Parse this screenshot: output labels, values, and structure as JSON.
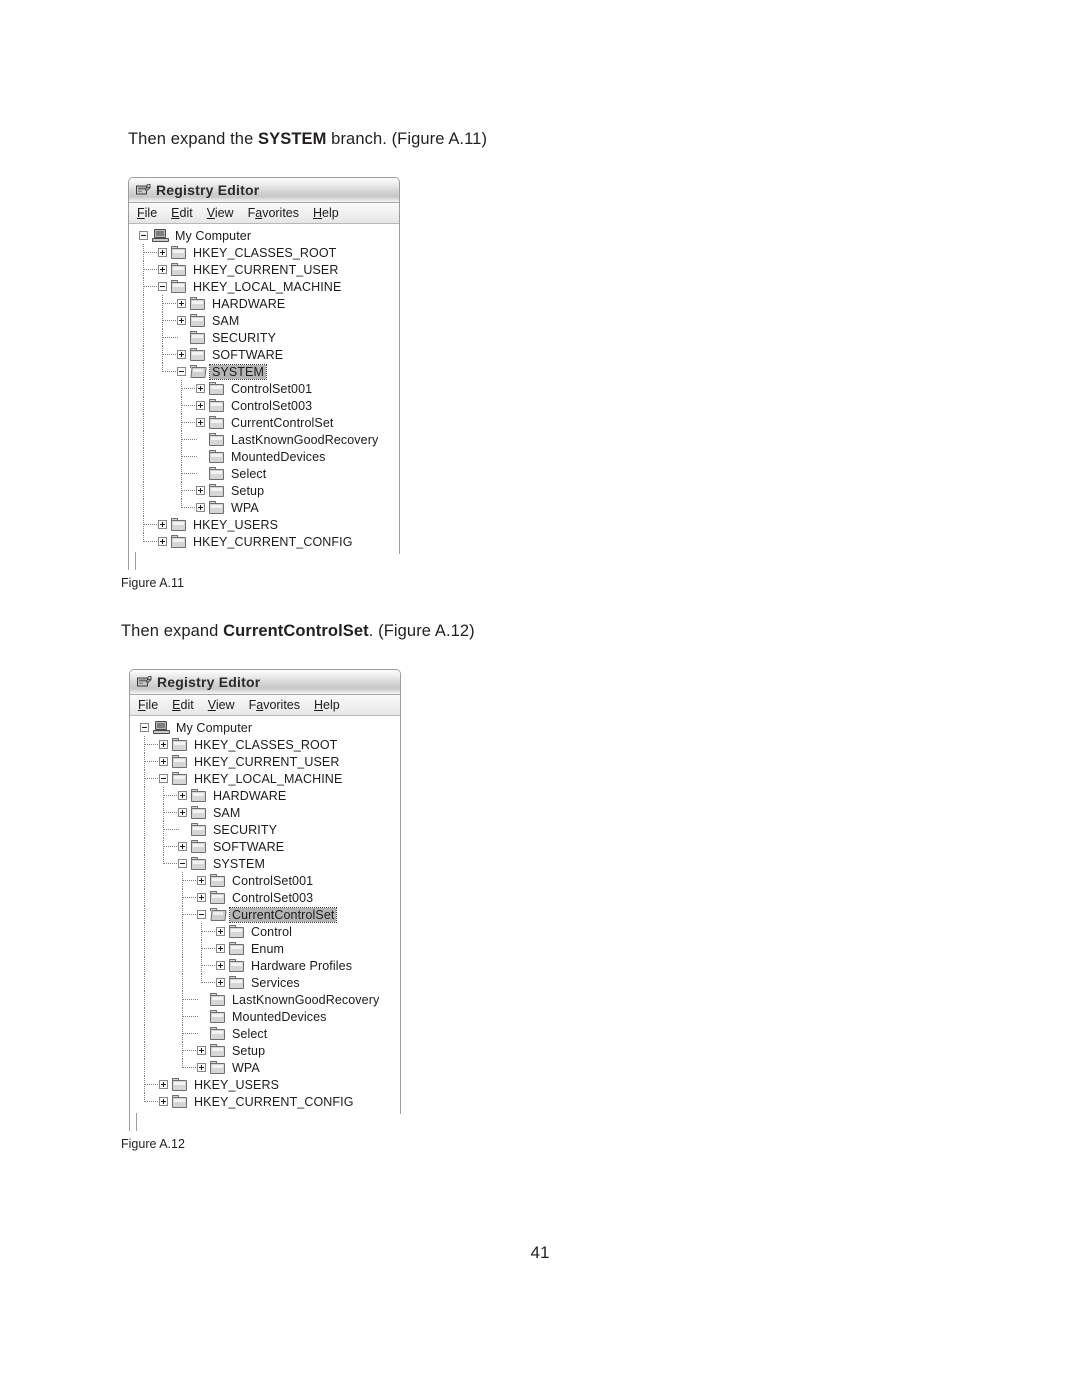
{
  "page": {
    "number": "41"
  },
  "paragraphs": [
    {
      "id": "para-1",
      "prefix": "Then expand the ",
      "emphasis": "SYSTEM",
      "suffix": " branch. (Figure A.11)"
    },
    {
      "id": "para-2",
      "prefix": "Then expand ",
      "emphasis": "CurrentControlSet",
      "suffix": ". (Figure A.12)"
    }
  ],
  "captions": {
    "figure_a11": "Figure A.11",
    "figure_a12": "Figure A.12"
  },
  "window": {
    "title": "Registry Editor",
    "title_icon": "registry-editor-icon",
    "menu": [
      {
        "pre": "",
        "key": "F",
        "post": "ile"
      },
      {
        "pre": "",
        "key": "E",
        "post": "dit"
      },
      {
        "pre": "",
        "key": "V",
        "post": "iew"
      },
      {
        "pre": "F",
        "key": "a",
        "post": "vorites"
      },
      {
        "pre": "",
        "key": "H",
        "post": "elp"
      }
    ]
  },
  "figure_a11": {
    "tree": [
      {
        "label": "My Computer",
        "depth": 0,
        "icon": "computer-icon",
        "expander": "minus",
        "selected": false
      },
      {
        "label": "HKEY_CLASSES_ROOT",
        "depth": 1,
        "icon": "folder-icon",
        "expander": "plus",
        "selected": false
      },
      {
        "label": "HKEY_CURRENT_USER",
        "depth": 1,
        "icon": "folder-icon",
        "expander": "plus",
        "selected": false
      },
      {
        "label": "HKEY_LOCAL_MACHINE",
        "depth": 1,
        "icon": "folder-icon",
        "expander": "minus",
        "selected": false
      },
      {
        "label": "HARDWARE",
        "depth": 2,
        "icon": "folder-icon",
        "expander": "plus",
        "selected": false
      },
      {
        "label": "SAM",
        "depth": 2,
        "icon": "folder-icon",
        "expander": "plus",
        "selected": false
      },
      {
        "label": "SECURITY",
        "depth": 2,
        "icon": "folder-icon",
        "expander": "none",
        "selected": false
      },
      {
        "label": "SOFTWARE",
        "depth": 2,
        "icon": "folder-icon",
        "expander": "plus",
        "selected": false
      },
      {
        "label": "SYSTEM",
        "depth": 2,
        "icon": "folder-open-icon",
        "expander": "minus",
        "selected": true
      },
      {
        "label": "ControlSet001",
        "depth": 3,
        "icon": "folder-icon",
        "expander": "plus",
        "selected": false
      },
      {
        "label": "ControlSet003",
        "depth": 3,
        "icon": "folder-icon",
        "expander": "plus",
        "selected": false
      },
      {
        "label": "CurrentControlSet",
        "depth": 3,
        "icon": "folder-icon",
        "expander": "plus",
        "selected": false
      },
      {
        "label": "LastKnownGoodRecovery",
        "depth": 3,
        "icon": "folder-icon",
        "expander": "none",
        "selected": false
      },
      {
        "label": "MountedDevices",
        "depth": 3,
        "icon": "folder-icon",
        "expander": "none",
        "selected": false
      },
      {
        "label": "Select",
        "depth": 3,
        "icon": "folder-icon",
        "expander": "none",
        "selected": false
      },
      {
        "label": "Setup",
        "depth": 3,
        "icon": "folder-icon",
        "expander": "plus",
        "selected": false
      },
      {
        "label": "WPA",
        "depth": 3,
        "icon": "folder-icon",
        "expander": "plus",
        "selected": false
      },
      {
        "label": "HKEY_USERS",
        "depth": 1,
        "icon": "folder-icon",
        "expander": "plus",
        "selected": false
      },
      {
        "label": "HKEY_CURRENT_CONFIG",
        "depth": 1,
        "icon": "folder-icon",
        "expander": "plus",
        "selected": false
      }
    ]
  },
  "figure_a12": {
    "tree": [
      {
        "label": "My Computer",
        "depth": 0,
        "icon": "computer-icon",
        "expander": "minus",
        "selected": false
      },
      {
        "label": "HKEY_CLASSES_ROOT",
        "depth": 1,
        "icon": "folder-icon",
        "expander": "plus",
        "selected": false
      },
      {
        "label": "HKEY_CURRENT_USER",
        "depth": 1,
        "icon": "folder-icon",
        "expander": "plus",
        "selected": false
      },
      {
        "label": "HKEY_LOCAL_MACHINE",
        "depth": 1,
        "icon": "folder-icon",
        "expander": "minus",
        "selected": false
      },
      {
        "label": "HARDWARE",
        "depth": 2,
        "icon": "folder-icon",
        "expander": "plus",
        "selected": false
      },
      {
        "label": "SAM",
        "depth": 2,
        "icon": "folder-icon",
        "expander": "plus",
        "selected": false
      },
      {
        "label": "SECURITY",
        "depth": 2,
        "icon": "folder-icon",
        "expander": "none",
        "selected": false
      },
      {
        "label": "SOFTWARE",
        "depth": 2,
        "icon": "folder-icon",
        "expander": "plus",
        "selected": false
      },
      {
        "label": "SYSTEM",
        "depth": 2,
        "icon": "folder-icon",
        "expander": "minus",
        "selected": false
      },
      {
        "label": "ControlSet001",
        "depth": 3,
        "icon": "folder-icon",
        "expander": "plus",
        "selected": false
      },
      {
        "label": "ControlSet003",
        "depth": 3,
        "icon": "folder-icon",
        "expander": "plus",
        "selected": false
      },
      {
        "label": "CurrentControlSet",
        "depth": 3,
        "icon": "folder-open-icon",
        "expander": "minus",
        "selected": true
      },
      {
        "label": "Control",
        "depth": 4,
        "icon": "folder-icon",
        "expander": "plus",
        "selected": false
      },
      {
        "label": "Enum",
        "depth": 4,
        "icon": "folder-icon",
        "expander": "plus",
        "selected": false
      },
      {
        "label": "Hardware Profiles",
        "depth": 4,
        "icon": "folder-icon",
        "expander": "plus",
        "selected": false
      },
      {
        "label": "Services",
        "depth": 4,
        "icon": "folder-icon",
        "expander": "plus",
        "selected": false
      },
      {
        "label": "LastKnownGoodRecovery",
        "depth": 3,
        "icon": "folder-icon",
        "expander": "none",
        "selected": false
      },
      {
        "label": "MountedDevices",
        "depth": 3,
        "icon": "folder-icon",
        "expander": "none",
        "selected": false
      },
      {
        "label": "Select",
        "depth": 3,
        "icon": "folder-icon",
        "expander": "none",
        "selected": false
      },
      {
        "label": "Setup",
        "depth": 3,
        "icon": "folder-icon",
        "expander": "plus",
        "selected": false
      },
      {
        "label": "WPA",
        "depth": 3,
        "icon": "folder-icon",
        "expander": "plus",
        "selected": false
      },
      {
        "label": "HKEY_USERS",
        "depth": 1,
        "icon": "folder-icon",
        "expander": "plus",
        "selected": false
      },
      {
        "label": "HKEY_CURRENT_CONFIG",
        "depth": 1,
        "icon": "folder-icon",
        "expander": "plus",
        "selected": false
      }
    ]
  }
}
